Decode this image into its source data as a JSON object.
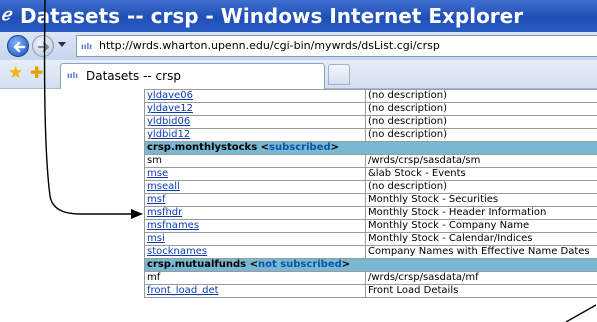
{
  "window": {
    "title": "Datasets -- crsp - Windows Internet Explorer"
  },
  "toolbar": {
    "address_url": "http://wrds.wharton.upenn.edu/cgi-bin/mywrds/dsList.cgi/crsp"
  },
  "tabs": [
    {
      "label": "Datasets -- crsp"
    }
  ],
  "rows_top": [
    {
      "name": "yldave06",
      "desc": "(no description)",
      "link": true
    },
    {
      "name": "yldave12",
      "desc": "(no description)",
      "link": true
    },
    {
      "name": "yldbid06",
      "desc": "(no description)",
      "link": true
    },
    {
      "name": "yldbid12",
      "desc": "(no description)",
      "link": true
    }
  ],
  "section_monthly": {
    "prefix": "crsp.monthlystocks <",
    "status": "subscribed",
    "suffix": ">"
  },
  "rows_monthly": [
    {
      "name": "sm",
      "desc": "/wrds/crsp/sasdata/sm",
      "link": false
    },
    {
      "name": "mse",
      "desc": "&lab Stock - Events",
      "link": true
    },
    {
      "name": "mseall",
      "desc": "(no description)",
      "link": true
    },
    {
      "name": "msf",
      "desc": "Monthly Stock - Securities",
      "link": true
    },
    {
      "name": "msfhdr",
      "desc": "Monthly Stock - Header Information",
      "link": true
    },
    {
      "name": "msfnames",
      "desc": "Monthly Stock - Company Name",
      "link": true
    },
    {
      "name": "msi",
      "desc": "Monthly Stock - Calendar/Indices",
      "link": true
    },
    {
      "name": "stocknames",
      "desc": "Company Names with Effective Name Dates",
      "link": true
    }
  ],
  "section_mutual": {
    "prefix": "crsp.mutualfunds <",
    "status": "not subscribed",
    "suffix": ">"
  },
  "rows_mutual": [
    {
      "name": "mf",
      "desc": "/wrds/crsp/sasdata/mf",
      "link": false
    },
    {
      "name": "front_load_det",
      "desc": "Front Load Details",
      "link": true
    }
  ],
  "colors": {
    "titlebar": "#2b5cc4",
    "section_header": "#7ab7d2",
    "link": "#0b3bb0"
  }
}
